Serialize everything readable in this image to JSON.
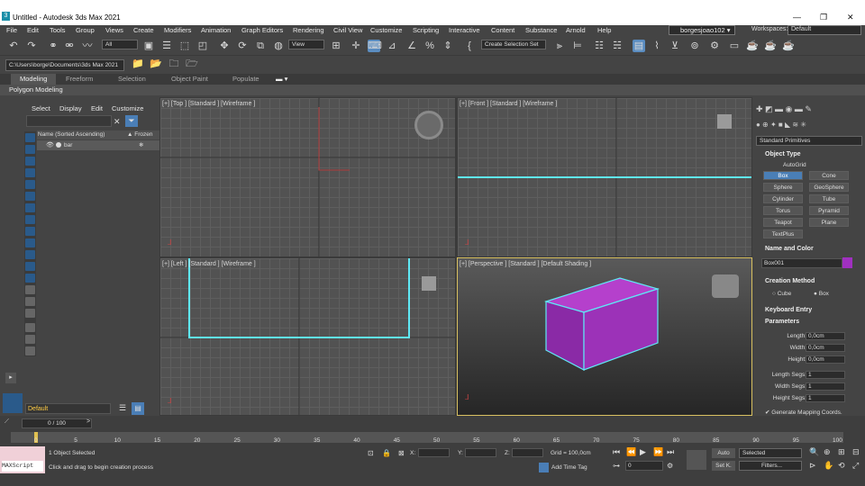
{
  "titlebar": {
    "title": "Untitled - Autodesk 3ds Max 2021"
  },
  "menu": [
    "File",
    "Edit",
    "Tools",
    "Group",
    "Views",
    "Create",
    "Modifiers",
    "Animation",
    "Graph Editors",
    "Rendering",
    "Civil View",
    "Customize",
    "Scripting",
    "Interactive",
    "Content",
    "Substance",
    "Arnold",
    "Help"
  ],
  "user": "borgesjoao102",
  "workspace": {
    "label": "Workspaces:",
    "value": "Default"
  },
  "toolbar": {
    "filter": "All",
    "refcoord": "View",
    "selset": "Create Selection Set"
  },
  "project_path": "C:\\Users\\borge\\Documents\\3ds Max 2021",
  "ribbon_tabs": [
    "Modeling",
    "Freeform",
    "Selection",
    "Object Paint",
    "Populate"
  ],
  "polygon_modeling": "Polygon Modeling",
  "scene": {
    "menus": [
      "Select",
      "Display",
      "Edit",
      "Customize"
    ],
    "col_name": "Name (Sorted Ascending)",
    "col_frozen": "▲ Frozen",
    "object": "bar"
  },
  "viewports": {
    "top": "[+] [Top ] [Standard ] [Wireframe ]",
    "front": "[+] [Front ] [Standard ] [Wireframe ]",
    "left": "[+] [Left ] [Standard ] [Wireframe ]",
    "persp": "[+] [Perspective ] [Standard ] [Default Shading ]"
  },
  "layer": "Default",
  "cmd": {
    "category": "Standard Primitives",
    "object_type": "Object Type",
    "autogrid": "AutoGrid",
    "buttons": [
      "Box",
      "Cone",
      "Sphere",
      "GeoSphere",
      "Cylinder",
      "Tube",
      "Torus",
      "Pyramid",
      "Teapot",
      "Plane",
      "TextPlus"
    ],
    "name_color": "Name and Color",
    "name": "Box001",
    "color": "#a030c0",
    "creation": "Creation Method",
    "cube": "Cube",
    "box": "Box",
    "keyboard": "Keyboard Entry",
    "parameters": "Parameters",
    "length": "Length:",
    "width": "Width:",
    "height": "Height:",
    "length_v": "0,0cm",
    "width_v": "0,0cm",
    "height_v": "0,0cm",
    "lsegs": "Length Segs:",
    "wsegs": "Width Segs:",
    "hsegs": "Height Segs:",
    "lsegs_v": "1",
    "wsegs_v": "1",
    "hsegs_v": "1",
    "genmap": "Generate Mapping Coords."
  },
  "timeline": {
    "frame": "0 / 100",
    "ticks": [
      "0",
      "5",
      "10",
      "15",
      "20",
      "25",
      "30",
      "35",
      "40",
      "45",
      "50",
      "55",
      "60",
      "65",
      "70",
      "75",
      "80",
      "85",
      "90",
      "95",
      "100"
    ]
  },
  "status": {
    "script": "MAXScript",
    "selected": "1 Object Selected",
    "prompt": "Click and drag to begin creation process",
    "x": "X:",
    "y": "Y:",
    "z": "Z:",
    "grid": "Grid = 100,0cm",
    "addtag": "Add Time Tag",
    "auto": "Auto",
    "setk": "Set K.",
    "selected_drop": "Selected",
    "filters": "Filters...",
    "frame": "0"
  }
}
